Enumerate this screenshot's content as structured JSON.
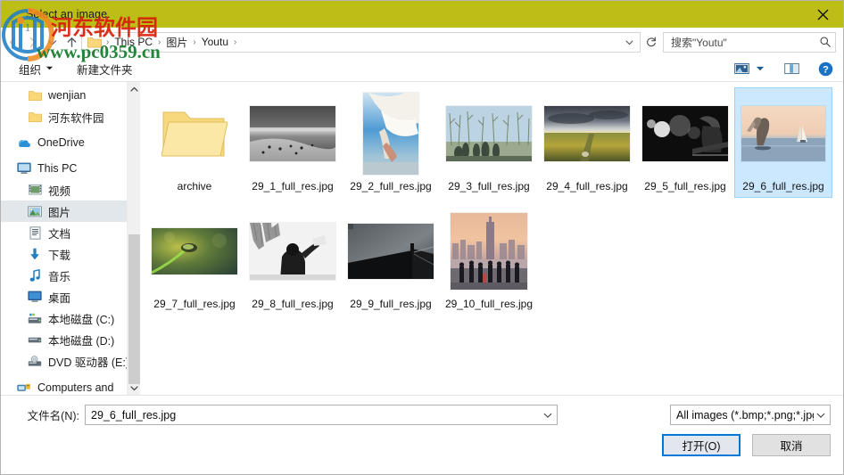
{
  "window": {
    "title": "Select an image.",
    "close_icon": "close-icon",
    "titlebar_color": "#bdbd18"
  },
  "address_bar": {
    "back_icon": "back-arrow-icon",
    "forward_icon": "forward-arrow-icon",
    "recent_icon": "chevron-down-icon",
    "up_icon": "up-arrow-icon",
    "folder_icon": "folder-icon",
    "breadcrumbs": [
      "This PC",
      "图片",
      "Youtu"
    ],
    "separator": "›",
    "dropdown_icon": "chevron-down-icon",
    "refresh_icon": "refresh-icon",
    "refresh_label": "↻"
  },
  "search": {
    "placeholder": "搜索\"Youtu\"",
    "icon": "search-icon"
  },
  "toolbar": {
    "organize_label": "组织",
    "organize_caret": "▾",
    "new_folder_label": "新建文件夹",
    "view_icon": "view-layout-icon",
    "view_caret_icon": "chevron-down-icon",
    "preview_pane_icon": "preview-pane-icon",
    "help_icon": "help-icon"
  },
  "sidebar": {
    "items": [
      {
        "label": "wenjian",
        "icon": "folder-icon",
        "kind": "folder",
        "indent": true,
        "selected": false
      },
      {
        "label": "河东软件园",
        "icon": "folder-icon",
        "kind": "folder",
        "indent": true,
        "selected": false
      },
      {
        "label": "OneDrive",
        "icon": "onedrive-cloud-icon",
        "kind": "cloud",
        "indent": false,
        "selected": false
      },
      {
        "label": "This PC",
        "icon": "monitor-icon",
        "kind": "pc",
        "indent": false,
        "selected": false
      },
      {
        "label": "视频",
        "icon": "videos-icon",
        "kind": "videos",
        "indent": true,
        "selected": false
      },
      {
        "label": "图片",
        "icon": "pictures-icon",
        "kind": "pictures",
        "indent": true,
        "selected": true
      },
      {
        "label": "文档",
        "icon": "documents-icon",
        "kind": "documents",
        "indent": true,
        "selected": false
      },
      {
        "label": "下载",
        "icon": "downloads-icon",
        "kind": "downloads",
        "indent": true,
        "selected": false
      },
      {
        "label": "音乐",
        "icon": "music-icon",
        "kind": "music",
        "indent": true,
        "selected": false
      },
      {
        "label": "桌面",
        "icon": "desktop-icon",
        "kind": "desktop",
        "indent": true,
        "selected": false
      },
      {
        "label": "本地磁盘 (C:)",
        "icon": "system-drive-icon",
        "kind": "sysdrive",
        "indent": true,
        "selected": false
      },
      {
        "label": "本地磁盘 (D:)",
        "icon": "drive-icon",
        "kind": "drive",
        "indent": true,
        "selected": false
      },
      {
        "label": "DVD 驱动器 (E:)",
        "icon": "dvd-drive-icon",
        "kind": "dvd",
        "indent": true,
        "selected": false
      },
      {
        "label": "Computers and",
        "icon": "network-icon",
        "kind": "network",
        "indent": false,
        "selected": false
      }
    ],
    "scroll_up_icon": "chevron-up-icon",
    "scroll_down_icon": "chevron-down-icon"
  },
  "files": [
    {
      "name": "archive",
      "kind": "folder",
      "selected": false
    },
    {
      "name": "29_1_full_res.jpg",
      "kind": "image",
      "thumb": "beach-bw",
      "selected": false
    },
    {
      "name": "29_2_full_res.jpg",
      "kind": "image",
      "thumb": "bird-sky",
      "selected": false
    },
    {
      "name": "29_3_full_res.jpg",
      "kind": "image",
      "thumb": "winter-trees",
      "selected": false
    },
    {
      "name": "29_4_full_res.jpg",
      "kind": "image",
      "thumb": "marsh-field",
      "selected": false
    },
    {
      "name": "29_5_full_res.jpg",
      "kind": "image",
      "thumb": "concert-bw",
      "selected": false
    },
    {
      "name": "29_6_full_res.jpg",
      "kind": "image",
      "thumb": "pelican-sunset",
      "selected": true
    },
    {
      "name": "29_7_full_res.jpg",
      "kind": "image",
      "thumb": "green-bokeh",
      "selected": false
    },
    {
      "name": "29_8_full_res.jpg",
      "kind": "image",
      "thumb": "person-bw",
      "selected": false
    },
    {
      "name": "29_9_full_res.jpg",
      "kind": "image",
      "thumb": "dark-roof",
      "selected": false
    },
    {
      "name": "29_10_full_res.jpg",
      "kind": "image",
      "thumb": "city-skyline",
      "selected": false
    }
  ],
  "bottom": {
    "filename_label": "文件名(N):",
    "filename_value": "29_6_full_res.jpg",
    "filename_chevron_icon": "chevron-down-icon",
    "filetype_value": "All images (*.bmp;*.png;*.jpg",
    "filetype_chevron_icon": "chevron-down-icon",
    "open_button": "打开(O)",
    "cancel_button": "取消"
  },
  "watermark": {
    "site_name": "河东软件园",
    "site_url": "www.pc0359.cn",
    "name_color": "#d81e06",
    "url_color": "#137a2b"
  }
}
